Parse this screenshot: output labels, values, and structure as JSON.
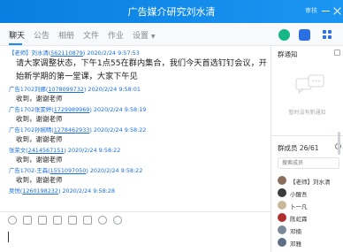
{
  "window": {
    "title": "广告媒介研究刘水清",
    "tag": "审核"
  },
  "tabs": [
    {
      "label": "聊天"
    },
    {
      "label": "公告"
    },
    {
      "label": "相册"
    },
    {
      "label": "文件"
    },
    {
      "label": "作业"
    },
    {
      "label": "设置"
    }
  ],
  "messages": [
    {
      "name": "【老师】刘水清",
      "uid": "562110879",
      "time": "2020/2/24 9:57:53",
      "text": "请大家调整状态，下午1点55在群内集合，我们今天首选钉钉会议，开始新学期的第一堂课，大家下午见"
    },
    {
      "name": "广告1702刘娜",
      "uid": "1078099732",
      "time": "2020/2/24 9:58:01",
      "text": "收到，谢谢老师"
    },
    {
      "name": "广告1702张雯婷",
      "uid": "1729989969",
      "time": "2020/2/24 9:58:19",
      "text": "收到，谢谢老师"
    },
    {
      "name": "广告1702孙婉晴",
      "uid": "1278462933",
      "time": "2020/2/24 9:58:22",
      "text": "收到，谢谢老师"
    },
    {
      "name": "张荣文",
      "uid": "2414567151",
      "time": "2020/2/24 9:58:22",
      "text": "收到，谢谢老师"
    },
    {
      "name": "广告1702-王森",
      "uid": "1551097050",
      "time": "2020/2/24 9:58:22",
      "text": "收到，谢谢老师"
    },
    {
      "name": "吴悦",
      "uid": "1260198232",
      "time": "2020/2/24 9:58:28",
      "text": ""
    }
  ],
  "sidebar": {
    "notice_title": "群通知",
    "notice_empty": "暂时没有新通知",
    "members_title": "群成员 26/61",
    "search_placeholder": "搜索成员",
    "members": [
      {
        "name": "【老师】刘水清",
        "color": "#8a6d5a"
      },
      {
        "name": "小醒吾",
        "color": "#3a3a3a"
      },
      {
        "name": "卜一凡",
        "color": "#c9b79c"
      },
      {
        "name": "陈虹霖",
        "color": "#b03030"
      },
      {
        "name": "邓楠",
        "color": "#7a8a9a"
      },
      {
        "name": "邓雅",
        "color": "#5b6e86"
      }
    ]
  }
}
